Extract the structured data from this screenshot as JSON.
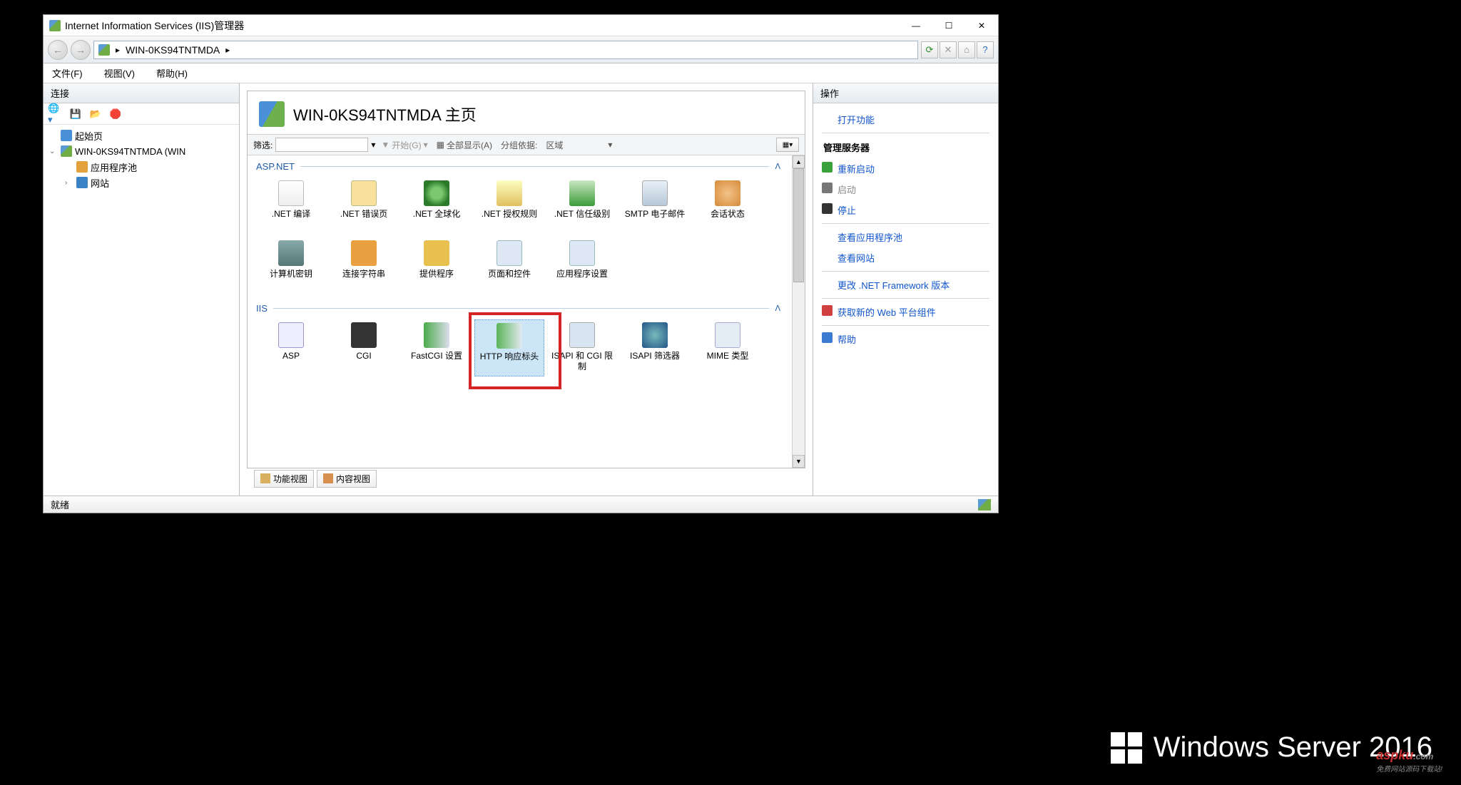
{
  "window": {
    "title": "Internet Information Services (IIS)管理器"
  },
  "breadcrumb": {
    "server": "WIN-0KS94TNTMDA"
  },
  "menu": {
    "file": "文件(F)",
    "view": "视图(V)",
    "help": "帮助(H)"
  },
  "connections": {
    "header": "连接",
    "start_page": "起始页",
    "server_node": "WIN-0KS94TNTMDA (WIN",
    "app_pools": "应用程序池",
    "sites": "网站"
  },
  "main": {
    "title": "WIN-0KS94TNTMDA 主页",
    "filter_label": "筛选:",
    "start_label": "开始(G)",
    "show_all": "全部显示(A)",
    "group_by": "分组依据:",
    "group_value": "区域"
  },
  "groups": {
    "aspnet": "ASP.NET",
    "iis": "IIS"
  },
  "icons": {
    "net_compile": ".NET 编译",
    "net_error": ".NET 错误页",
    "net_global": ".NET 全球化",
    "net_auth": ".NET 授权规则",
    "net_trust": ".NET 信任级别",
    "smtp": "SMTP 电子邮件",
    "session": "会话状态",
    "machine_key": "计算机密钥",
    "conn_str": "连接字符串",
    "providers": "提供程序",
    "pages_ctrl": "页面和控件",
    "app_settings": "应用程序设置",
    "asp": "ASP",
    "cgi": "CGI",
    "fastcgi": "FastCGI 设置",
    "http_headers": "HTTP 响应标头",
    "isapi_cgi": "ISAPI 和 CGI 限制",
    "isapi_filter": "ISAPI 筛选器",
    "mime": "MIME 类型"
  },
  "view_tabs": {
    "features": "功能视图",
    "content": "内容视图"
  },
  "actions": {
    "header": "操作",
    "open_feature": "打开功能",
    "manage_server": "管理服务器",
    "restart": "重新启动",
    "start": "启动",
    "stop": "停止",
    "view_pools": "查看应用程序池",
    "view_sites": "查看网站",
    "change_net": "更改 .NET Framework 版本",
    "get_webpi": "获取新的 Web 平台组件",
    "help": "帮助"
  },
  "status": "就绪",
  "brand": "Windows Server 2016",
  "watermark": "aspku",
  "watermark_sub": "免费网站源码下载站!"
}
